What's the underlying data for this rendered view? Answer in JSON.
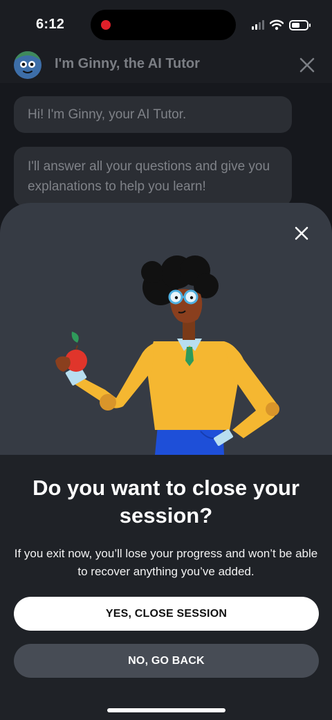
{
  "status_bar": {
    "time": "6:12",
    "recording": true,
    "icons": [
      "signal-icon",
      "wifi-icon",
      "battery-icon"
    ]
  },
  "header": {
    "title": "I'm Ginny, the AI Tutor",
    "avatar_icon": "ginny-avatar-icon",
    "close_icon": "close-icon"
  },
  "chat": {
    "messages": [
      "Hi! I'm Ginny, your AI Tutor.",
      "I'll answer all your questions and give you explanations to help you learn!"
    ]
  },
  "dialog": {
    "close_icon": "close-icon",
    "illustration": "tutor-holding-apple-illustration",
    "title": "Do you want to close your session?",
    "body": "If you exit now, you’ll lose your progress and won’t be able to recover anything you’ve added.",
    "confirm_label": "YES, CLOSE SESSION",
    "cancel_label": "NO, GO BACK"
  },
  "colors": {
    "background": "#16181d",
    "sheet": "#1f2227",
    "illustration_bg": "#363b44",
    "bubble": "#2b2e34",
    "primary_button": "#ffffff",
    "secondary_button": "#474c55",
    "sweater": "#f5b731",
    "pants": "#1e4fd8"
  }
}
